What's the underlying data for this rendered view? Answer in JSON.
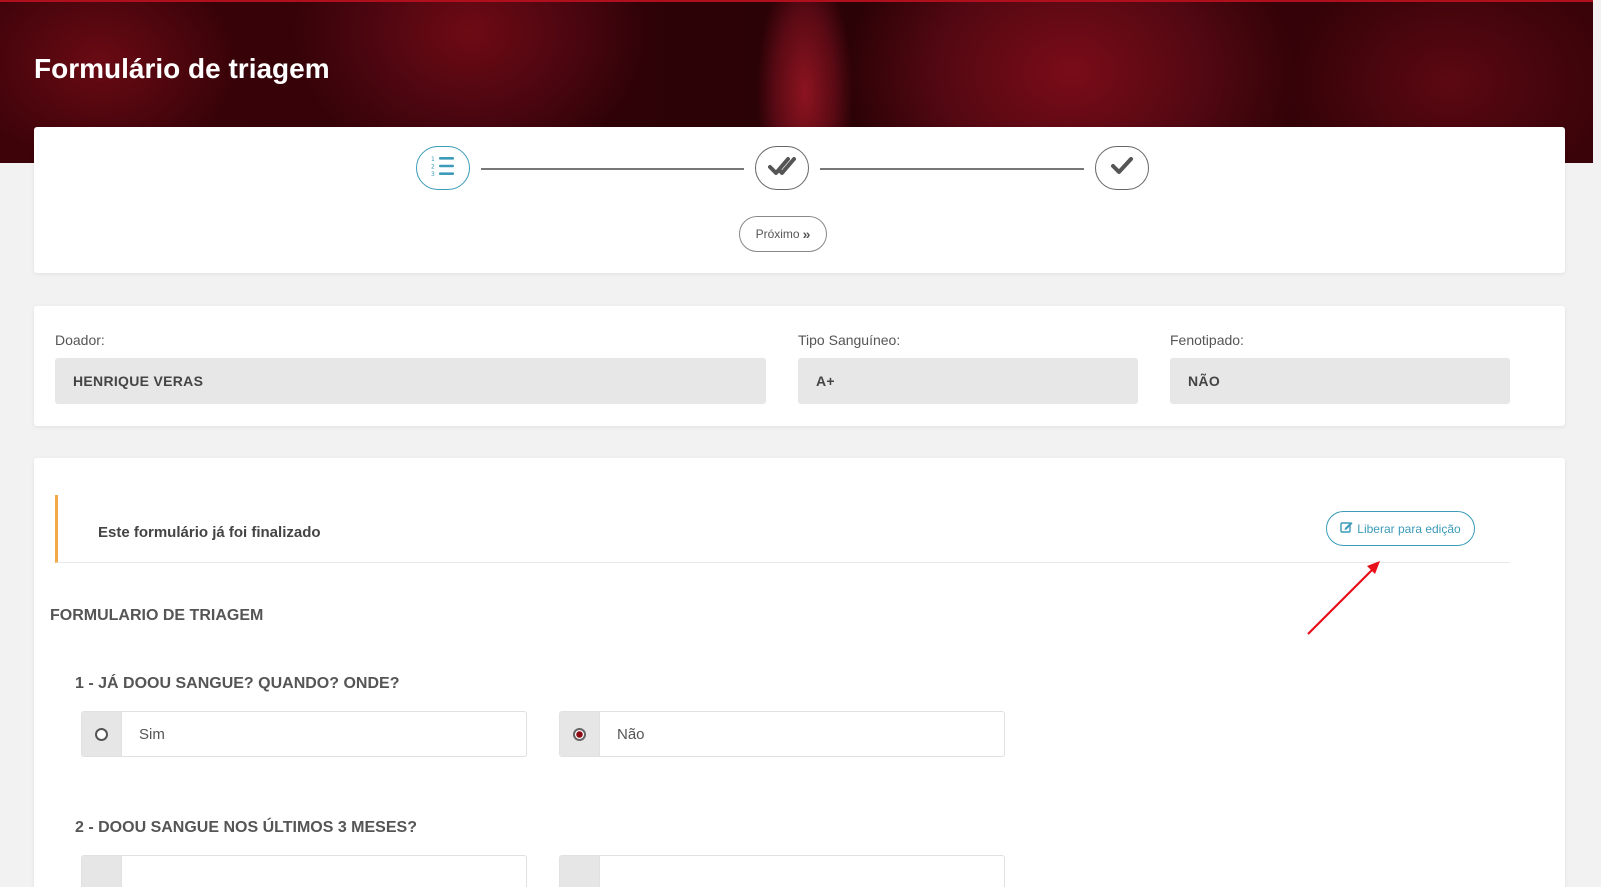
{
  "header": {
    "title": "Formulário de triagem"
  },
  "stepper": {
    "steps": [
      {
        "icon": "list-numbered-icon",
        "active": true
      },
      {
        "icon": "double-check-icon",
        "active": false
      },
      {
        "icon": "check-icon",
        "active": false
      }
    ],
    "next_label": "Próximo",
    "next_icon": "»"
  },
  "donor": {
    "donor_label": "Doador:",
    "donor_value": "HENRIQUE VERAS",
    "blood_type_label": "Tipo Sanguíneo:",
    "blood_type_value": "A+",
    "phenotyped_label": "Fenotipado:",
    "phenotyped_value": "NÃO"
  },
  "form": {
    "alert_text": "Este formulário já foi finalizado",
    "alert_color": "#f4a948",
    "release_label": "Liberar para edição",
    "section_title": "FORMULARIO DE TRIAGEM",
    "questions": [
      {
        "text": "1 - JÁ DOOU SANGUE? QUANDO? ONDE?",
        "options": [
          {
            "label": "Sim",
            "checked": false
          },
          {
            "label": "Não",
            "checked": true
          }
        ]
      },
      {
        "text": "2 - DOOU SANGUE NOS ÚLTIMOS 3 MESES?",
        "options": [
          {
            "label": "",
            "checked": false
          },
          {
            "label": "",
            "checked": false
          }
        ]
      }
    ]
  },
  "colors": {
    "accent": "#3b9bb8",
    "hero": "#3d0309",
    "annotation": "#e8101a"
  }
}
